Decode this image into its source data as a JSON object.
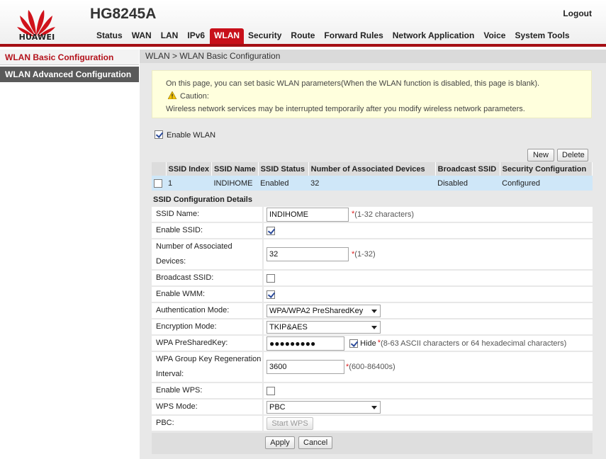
{
  "brand": {
    "logo_text": "HUAWEI",
    "model": "HG8245A",
    "color": "#c8101a"
  },
  "header": {
    "logout": "Logout"
  },
  "nav": {
    "items": [
      "Status",
      "WAN",
      "LAN",
      "IPv6",
      "WLAN",
      "Security",
      "Route",
      "Forward Rules",
      "Network Application",
      "Voice",
      "System Tools"
    ],
    "active": "WLAN"
  },
  "sidebar": {
    "items": [
      {
        "label": "WLAN Basic Configuration"
      },
      {
        "label": "WLAN Advanced Configuration"
      }
    ]
  },
  "breadcrumb": "WLAN > WLAN Basic Configuration",
  "notice": {
    "line1": "On this page, you can set basic WLAN parameters(When the WLAN function is disabled, this page is blank).",
    "caution": "Caution:",
    "line3": "Wireless network services may be interrupted temporarily after you modify wireless network parameters."
  },
  "enable_wlan": {
    "label": "Enable WLAN",
    "checked": true
  },
  "buttons": {
    "new": "New",
    "delete": "Delete",
    "apply": "Apply",
    "cancel": "Cancel",
    "start_wps": "Start WPS"
  },
  "ssid_table": {
    "headers": [
      "SSID Index",
      "SSID Name",
      "SSID Status",
      "Number of Associated Devices",
      "Broadcast SSID",
      "Security Configuration"
    ],
    "rows": [
      {
        "index": "1",
        "name": "INDIHOME",
        "status": "Enabled",
        "devices": "32",
        "broadcast": "Disabled",
        "security": "Configured"
      }
    ]
  },
  "details": {
    "title": "SSID Configuration Details",
    "ssid_name": {
      "label": "SSID Name:",
      "value": "INDIHOME",
      "hint": "(1-32 characters)"
    },
    "enable_ssid": {
      "label": "Enable SSID:",
      "checked": true
    },
    "assoc_devices": {
      "label_1": "Number of Associated",
      "label_2": "Devices:",
      "value": "32",
      "hint": "(1-32)"
    },
    "broadcast_ssid": {
      "label": "Broadcast SSID:",
      "checked": false
    },
    "enable_wmm": {
      "label": "Enable WMM:",
      "checked": true
    },
    "auth_mode": {
      "label": "Authentication Mode:",
      "value": "WPA/WPA2 PreSharedKey"
    },
    "encryption_mode": {
      "label": "Encryption Mode:",
      "value": "TKIP&AES"
    },
    "psk": {
      "label": "WPA PreSharedKey:",
      "value": "●●●●●●●●●",
      "hide_label": "Hide",
      "hint": "(8-63 ASCII characters or 64 hexadecimal characters)",
      "hide_checked": true
    },
    "group_key": {
      "label_1": "WPA Group Key Regeneration",
      "label_2": "Interval:",
      "value": "3600",
      "hint": "(600-86400s)"
    },
    "enable_wps": {
      "label": "Enable WPS:",
      "checked": false
    },
    "wps_mode": {
      "label": "WPS Mode:",
      "value": "PBC"
    },
    "pbc": {
      "label": "PBC:"
    }
  },
  "required_mark": "*"
}
